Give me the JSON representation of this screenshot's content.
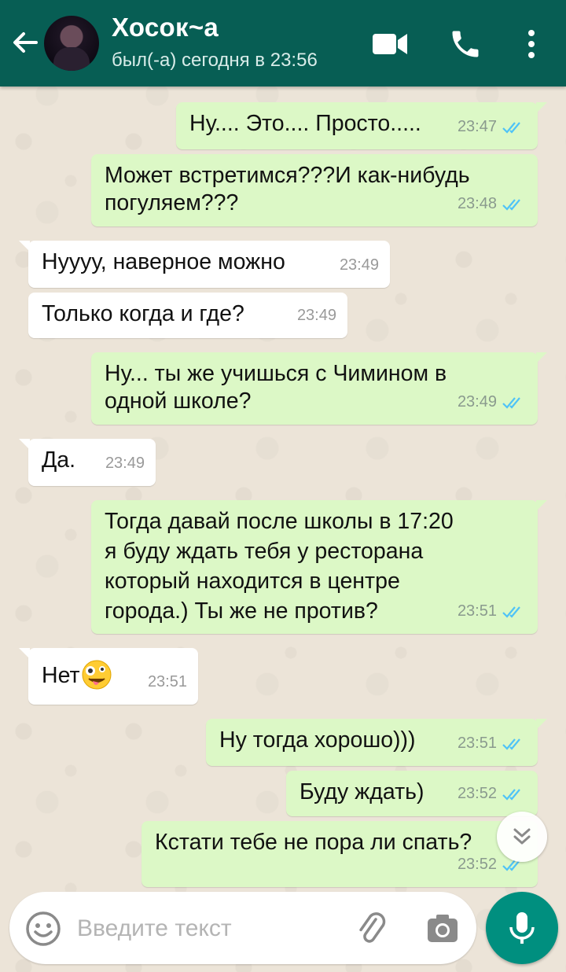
{
  "header": {
    "contact_name": "Хосок~а",
    "last_seen": "был(-а) сегодня в 23:56"
  },
  "messages": [
    {
      "dir": "out",
      "text": "Ну.... Это.... Просто.....",
      "time": "23:47",
      "status": "read"
    },
    {
      "dir": "out",
      "text": "Может встретимся???И как-нибудь погуляем???",
      "lines": [
        "Может встретимся???И как-нибудь",
        "погуляем???"
      ],
      "time": "23:48",
      "status": "read"
    },
    {
      "dir": "in",
      "text": "Нуууу, наверное можно",
      "time": "23:49"
    },
    {
      "dir": "in",
      "text": "Только когда и где?",
      "time": "23:49"
    },
    {
      "dir": "out",
      "text": "Ну... ты же учишься с Чимином в одной школе?",
      "lines": [
        "Ну... ты же учишься с Чимином в",
        "одной школе?"
      ],
      "time": "23:49",
      "status": "read"
    },
    {
      "dir": "in",
      "text": "Да.",
      "time": "23:49"
    },
    {
      "dir": "out",
      "text": "Тогда давай после школы в 17:20 я буду ждать тебя у ресторана который находится в центре города.) Ты же не против?",
      "lines": [
        "Тогда давай после школы в 17:20",
        "я буду ждать тебя у ресторана",
        "который находится в центре",
        "города.) Ты же не против?"
      ],
      "time": "23:51",
      "status": "read"
    },
    {
      "dir": "in",
      "text": "Нет",
      "emoji": "zany-face",
      "time": "23:51"
    },
    {
      "dir": "out",
      "text": "Ну тогда хорошо)))",
      "time": "23:51",
      "status": "read"
    },
    {
      "dir": "out",
      "text": "Буду ждать)",
      "time": "23:52",
      "status": "read"
    },
    {
      "dir": "out",
      "text": "Кстати тебе не пора ли спать?",
      "time": "23:52",
      "status": "read"
    }
  ],
  "composer": {
    "placeholder": "Введите текст"
  },
  "colors": {
    "header": "#075e54",
    "outgoing_bubble": "#dcf8c6",
    "incoming_bubble": "#ffffff",
    "read_ticks": "#4fc3f7",
    "mic_button": "#008f7f"
  },
  "icons": {
    "back": "arrow-left-icon",
    "video": "video-call-icon",
    "call": "phone-icon",
    "menu": "more-vert-icon",
    "emoji": "smiley-icon",
    "attach": "paperclip-icon",
    "camera": "camera-icon",
    "mic": "mic-icon",
    "scroll": "double-chevron-down-icon"
  }
}
